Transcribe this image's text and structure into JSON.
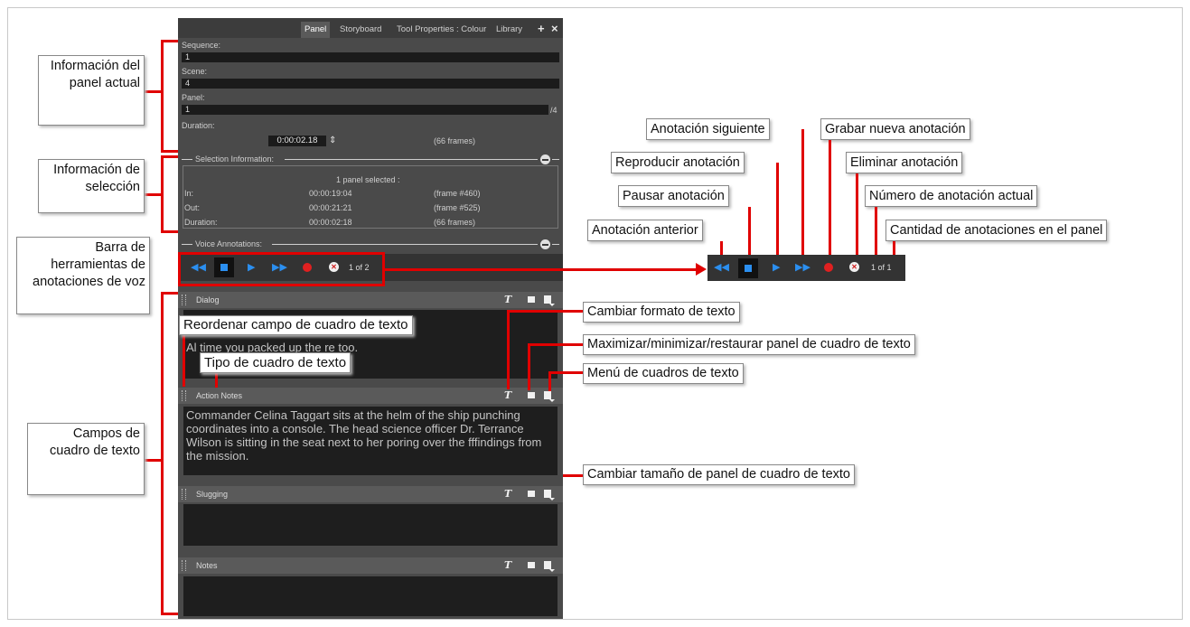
{
  "panel": {
    "tabs": [
      "Panel",
      "Storyboard",
      "Tool Properties : Colour",
      "Library"
    ],
    "tab_add_icon": "+",
    "tab_close_icon": "×",
    "sequence_label": "Sequence:",
    "sequence_value": "1",
    "scene_label": "Scene:",
    "scene_value": "4",
    "panel_label": "Panel:",
    "panel_value": "1",
    "panel_total": "/4",
    "duration_label": "Duration:",
    "duration_value": "0:00:02.18",
    "duration_frames": "(66 frames)",
    "selection": {
      "header": "Selection Information:",
      "selected": "1 panel selected :",
      "rows": [
        {
          "label": "In:",
          "time": "00:00:19:04",
          "frame": "(frame #460)"
        },
        {
          "label": "Out:",
          "time": "00:00:21:21",
          "frame": "(frame #525)"
        },
        {
          "label": "Duration:",
          "time": "00:00:02:18",
          "frame": "(66 frames)"
        }
      ]
    },
    "voice": {
      "header": "Voice Annotations:",
      "count": "1 of 2"
    },
    "text_boxes": [
      {
        "title": "Dialog",
        "text": "Al                         time you packed up the re                              too."
      },
      {
        "title": "Action Notes",
        "text": "Commander Celina Taggart sits at the helm of the ship punching coordinates into a console. The head science officer Dr. Terrance Wilson is sitting in the seat next to her poring over the fffindings from the mission."
      },
      {
        "title": "Slugging",
        "text": ""
      },
      {
        "title": "Notes",
        "text": ""
      }
    ]
  },
  "right_toolbar": {
    "count": "1 of 1"
  },
  "callouts": {
    "current_panel_info": "Información del panel actual",
    "selection_info": "Información de selección",
    "voice_toolbar": "Barra de herramientas de anotaciones de voz",
    "text_fields": "Campos de cuadro de texto",
    "reorder_field": "Reordenar campo de cuadro de texto",
    "text_box_type": "Tipo de cuadro de texto",
    "change_format": "Cambiar formato de texto",
    "max_min_restore": "Maximizar/minimizar/restaurar panel de cuadro de texto",
    "text_box_menu": "Menú de cuadros de texto",
    "resize_panel": "Cambiar tamaño de panel de cuadro de texto",
    "next_annotation": "Anotación siguiente",
    "record_new": "Grabar nueva anotación",
    "play_annotation": "Reproducir anotación",
    "delete_annotation": "Eliminar anotación",
    "pause_annotation": "Pausar anotación",
    "current_annotation_number": "Número de anotación actual",
    "previous_annotation": "Anotación anterior",
    "annotation_count": "Cantidad de anotaciones en el panel"
  },
  "colors": {
    "callout_line": "#e00000",
    "panel_bg": "#4a4a4a",
    "play_blue": "#2b8ff0",
    "record_red": "#e02020"
  },
  "icons": [
    "rewind-icon",
    "stop-icon",
    "play-icon",
    "fast-forward-icon",
    "record-icon",
    "delete-icon",
    "text-format-icon",
    "window-icon",
    "menu-icon",
    "grip-icon"
  ]
}
